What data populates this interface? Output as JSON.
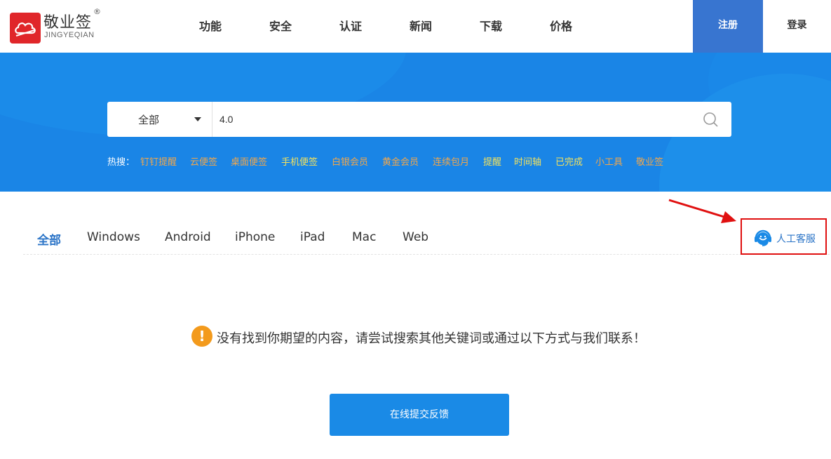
{
  "logo": {
    "name_cn": "敬业签",
    "registered": "®",
    "name_en": "JINGYEQIAN"
  },
  "nav": [
    "功能",
    "安全",
    "认证",
    "新闻",
    "下载",
    "价格"
  ],
  "auth": {
    "register": "注册",
    "login": "登录"
  },
  "search": {
    "scope": "全部",
    "value": "4.0",
    "icon": "search-icon"
  },
  "hot": {
    "label": "热搜：",
    "items": [
      "钉钉提醒",
      "云便签",
      "桌面便签",
      "手机便签",
      "白银会员",
      "黄金会员",
      "连续包月",
      "提醒",
      "时间轴",
      "已完成",
      "小工具",
      "敬业签"
    ]
  },
  "tabs": [
    "全部",
    "Windows",
    "Android",
    "iPhone",
    "iPad",
    "Mac",
    "Web"
  ],
  "service": {
    "label": "人工客服",
    "icon": "headset-icon"
  },
  "notice": {
    "icon": "!",
    "text": "没有找到你期望的内容，请尝试搜索其他关键词或通过以下方式与我们联系！"
  },
  "feedback": {
    "label": "在线提交反馈"
  },
  "colors": {
    "banner": "#1a85e6",
    "register": "#3875d0",
    "accent": "#2b74c7",
    "highlight": "#e01010",
    "hot_orange": "#f2a74b",
    "hot_yellow": "#f5e25c"
  }
}
